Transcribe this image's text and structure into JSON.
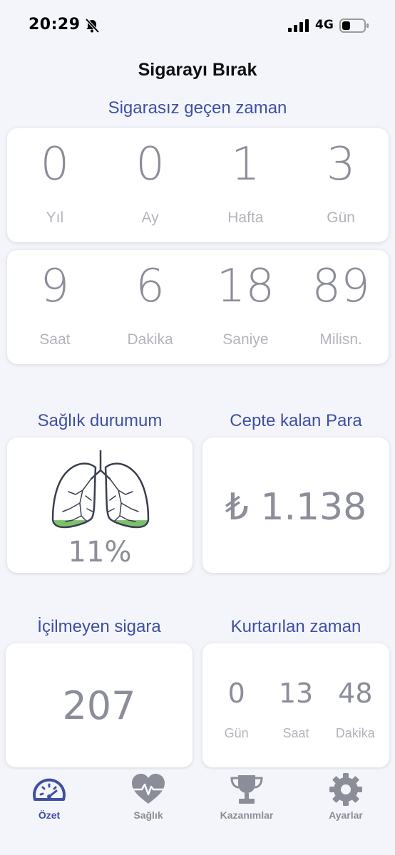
{
  "status_bar": {
    "time": "20:29",
    "network": "4G"
  },
  "app_title": "Sigarayı Bırak",
  "smoke_free": {
    "title": "Sigarasız geçen zaman",
    "row1": [
      {
        "value": "0",
        "label": "Yıl"
      },
      {
        "value": "0",
        "label": "Ay"
      },
      {
        "value": "1",
        "label": "Hafta"
      },
      {
        "value": "3",
        "label": "Gün"
      }
    ],
    "row2": [
      {
        "value": "9",
        "label": "Saat"
      },
      {
        "value": "6",
        "label": "Dakika"
      },
      {
        "value": "18",
        "label": "Saniye"
      },
      {
        "value": "89",
        "label": "Milisn."
      }
    ]
  },
  "health": {
    "title": "Sağlık durumum",
    "percent_text": "11%",
    "fill_fraction": 0.11,
    "fill_color": "#7cc16a"
  },
  "money": {
    "title": "Cepte kalan Para",
    "value": "₺ 1.138"
  },
  "cigarettes": {
    "title": "İçilmeyen sigara",
    "value": "207"
  },
  "saved_time": {
    "title": "Kurtarılan zaman",
    "items": [
      {
        "value": "0",
        "label": "Gün"
      },
      {
        "value": "13",
        "label": "Saat"
      },
      {
        "value": "48",
        "label": "Dakika"
      }
    ]
  },
  "tabs": [
    {
      "label": "Özet",
      "icon": "speedometer-icon",
      "active": true
    },
    {
      "label": "Sağlık",
      "icon": "heart-pulse-icon",
      "active": false
    },
    {
      "label": "Kazanımlar",
      "icon": "trophy-icon",
      "active": false
    },
    {
      "label": "Ayarlar",
      "icon": "gear-icon",
      "active": false
    }
  ],
  "colors": {
    "accent": "#3f4fa3",
    "value_gray": "#8b8d99",
    "label_gray": "#b2b4bd"
  }
}
